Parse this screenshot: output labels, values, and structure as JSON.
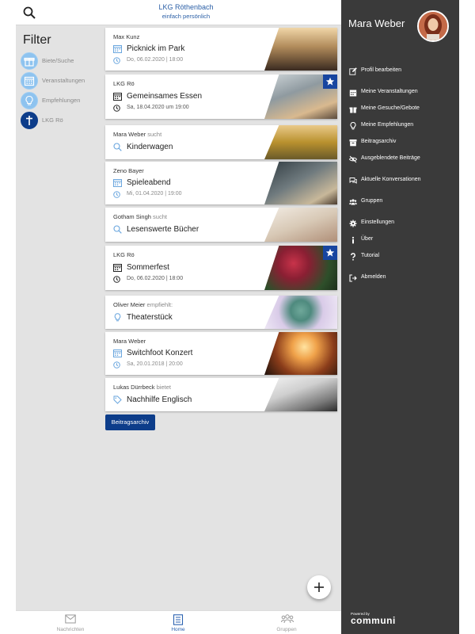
{
  "header": {
    "brand_title": "LKG Röthenbach",
    "brand_subtitle": "einfach persönlich"
  },
  "filter": {
    "title": "Filter",
    "items": [
      {
        "label": "Biete/Suche",
        "icon": "gift-icon"
      },
      {
        "label": "Veranstaltungen",
        "icon": "calendar-icon"
      },
      {
        "label": "Empfehlungen",
        "icon": "lightbulb-icon"
      },
      {
        "label": "LKG Rö",
        "icon": "cross-icon"
      }
    ]
  },
  "posts": [
    {
      "author": "Max Kunz",
      "verb": "",
      "title": "Picknick im Park",
      "title_icon": "calendar-icon",
      "meta": "Do, 06.02.2020 | 18:00",
      "starred": false
    },
    {
      "author": "LKG Rö",
      "verb": "",
      "title": "Gemeinsames Essen",
      "title_icon": "calendar-icon",
      "meta": "Sa, 18.04.2020 um 19:00",
      "starred": true
    },
    {
      "author": "Mara Weber",
      "verb": "sucht",
      "title": "Kinderwagen",
      "title_icon": "search-icon",
      "meta": "",
      "starred": false
    },
    {
      "author": "Zeno Bayer",
      "verb": "",
      "title": "Spieleabend",
      "title_icon": "calendar-icon",
      "meta": "Mi, 01.04.2020 | 19:00",
      "starred": false
    },
    {
      "author": "Gotham Singh",
      "verb": "sucht",
      "title": "Lesenswerte Bücher",
      "title_icon": "search-icon",
      "meta": "",
      "starred": false
    },
    {
      "author": "LKG Rö",
      "verb": "",
      "title": "Sommerfest",
      "title_icon": "calendar-icon",
      "meta": "Do, 06.02.2020 | 18:00",
      "starred": true
    },
    {
      "author": "Oliver Meier",
      "verb": "empfiehlt:",
      "title": "Theaterstück",
      "title_icon": "lightbulb-icon",
      "meta": "",
      "starred": false
    },
    {
      "author": "Mara Weber",
      "verb": "",
      "title": "Switchfoot Konzert",
      "title_icon": "calendar-icon",
      "meta": "Sa, 20.01.2018 | 20:00",
      "starred": false
    },
    {
      "author": "Lukas Dürrbeck",
      "verb": "bietet",
      "title": "Nachhilfe Englisch",
      "title_icon": "tag-icon",
      "meta": "",
      "starred": false
    }
  ],
  "archive_button": "Beitragsarchiv",
  "bottom_nav": [
    {
      "label": "Nachrichten",
      "icon": "mail-icon",
      "active": false
    },
    {
      "label": "Home",
      "icon": "list-icon",
      "active": true
    },
    {
      "label": "Gruppen",
      "icon": "group-icon",
      "active": false
    }
  ],
  "drawer": {
    "user_name": "Mara Weber",
    "menu": [
      {
        "label": "Profil bearbeiten",
        "icon": "edit-icon"
      },
      {
        "label": "Meine Veranstaltungen",
        "icon": "calendar-icon"
      },
      {
        "label": "Meine Gesuche/Gebote",
        "icon": "gift-icon"
      },
      {
        "label": "Meine Empfehlungen",
        "icon": "lightbulb-icon"
      },
      {
        "label": "Beitragsarchiv",
        "icon": "archive-icon"
      },
      {
        "label": "Ausgeblendete Beiträge",
        "icon": "eye-off-icon"
      },
      {
        "label": "Aktuelle Konversationen",
        "icon": "chat-icon"
      },
      {
        "label": "Gruppen",
        "icon": "group-icon"
      },
      {
        "label": "Einstellungen",
        "icon": "gear-icon"
      },
      {
        "label": "Über",
        "icon": "info-icon"
      },
      {
        "label": "Tutorial",
        "icon": "question-icon"
      },
      {
        "label": "Abmelden",
        "icon": "logout-icon"
      }
    ],
    "powered_by": "Powered by",
    "logo_text": "communi"
  },
  "colors": {
    "brand_blue": "#0d3d8a",
    "drawer_bg": "#3a3a3a",
    "filter_icon": "#8ec3ef"
  }
}
